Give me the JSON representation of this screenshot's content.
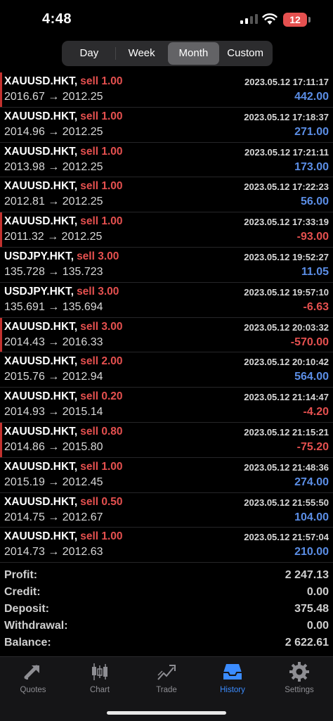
{
  "status_bar": {
    "time": "4:48",
    "battery": "12"
  },
  "period_tabs": [
    "Day",
    "Week",
    "Month",
    "Custom"
  ],
  "active_period": "Month",
  "deals": [
    {
      "symbol": "XAUUSD.HKT,",
      "side": "sell 1.00",
      "prices": "2016.67 → 2012.25",
      "time": "2023.05.12 17:11:17",
      "profit": "442.00",
      "positive": true,
      "flag": true
    },
    {
      "symbol": "XAUUSD.HKT,",
      "side": "sell 1.00",
      "prices": "2014.96 → 2012.25",
      "time": "2023.05.12 17:18:37",
      "profit": "271.00",
      "positive": true,
      "flag": false
    },
    {
      "symbol": "XAUUSD.HKT,",
      "side": "sell 1.00",
      "prices": "2013.98 → 2012.25",
      "time": "2023.05.12 17:21:11",
      "profit": "173.00",
      "positive": true,
      "flag": false
    },
    {
      "symbol": "XAUUSD.HKT,",
      "side": "sell 1.00",
      "prices": "2012.81 → 2012.25",
      "time": "2023.05.12 17:22:23",
      "profit": "56.00",
      "positive": true,
      "flag": false
    },
    {
      "symbol": "XAUUSD.HKT,",
      "side": "sell 1.00",
      "prices": "2011.32 → 2012.25",
      "time": "2023.05.12 17:33:19",
      "profit": "-93.00",
      "positive": false,
      "flag": true
    },
    {
      "symbol": "USDJPY.HKT,",
      "side": "sell 3.00",
      "prices": "135.728 → 135.723",
      "time": "2023.05.12 19:52:27",
      "profit": "11.05",
      "positive": true,
      "flag": false
    },
    {
      "symbol": "USDJPY.HKT,",
      "side": "sell 3.00",
      "prices": "135.691 → 135.694",
      "time": "2023.05.12 19:57:10",
      "profit": "-6.63",
      "positive": false,
      "flag": false
    },
    {
      "symbol": "XAUUSD.HKT,",
      "side": "sell 3.00",
      "prices": "2014.43 → 2016.33",
      "time": "2023.05.12 20:03:32",
      "profit": "-570.00",
      "positive": false,
      "flag": true
    },
    {
      "symbol": "XAUUSD.HKT,",
      "side": "sell 2.00",
      "prices": "2015.76 → 2012.94",
      "time": "2023.05.12 20:10:42",
      "profit": "564.00",
      "positive": true,
      "flag": false
    },
    {
      "symbol": "XAUUSD.HKT,",
      "side": "sell 0.20",
      "prices": "2014.93 → 2015.14",
      "time": "2023.05.12 21:14:47",
      "profit": "-4.20",
      "positive": false,
      "flag": false
    },
    {
      "symbol": "XAUUSD.HKT,",
      "side": "sell 0.80",
      "prices": "2014.86 → 2015.80",
      "time": "2023.05.12 21:15:21",
      "profit": "-75.20",
      "positive": false,
      "flag": true
    },
    {
      "symbol": "XAUUSD.HKT,",
      "side": "sell 1.00",
      "prices": "2015.19 → 2012.45",
      "time": "2023.05.12 21:48:36",
      "profit": "274.00",
      "positive": true,
      "flag": false
    },
    {
      "symbol": "XAUUSD.HKT,",
      "side": "sell 0.50",
      "prices": "2014.75 → 2012.67",
      "time": "2023.05.12 21:55:50",
      "profit": "104.00",
      "positive": true,
      "flag": false
    },
    {
      "symbol": "XAUUSD.HKT,",
      "side": "sell 1.00",
      "prices": "2014.73 → 2012.63",
      "time": "2023.05.12 21:57:04",
      "profit": "210.00",
      "positive": true,
      "flag": false
    }
  ],
  "summary": [
    {
      "label": "Profit:",
      "value": "2 247.13"
    },
    {
      "label": "Credit:",
      "value": "0.00"
    },
    {
      "label": "Deposit:",
      "value": "375.48"
    },
    {
      "label": "Withdrawal:",
      "value": "0.00"
    },
    {
      "label": "Balance:",
      "value": "2 622.61"
    }
  ],
  "tabs": [
    {
      "label": "Quotes",
      "icon": "quotes-icon"
    },
    {
      "label": "Chart",
      "icon": "chart-icon"
    },
    {
      "label": "Trade",
      "icon": "trade-icon"
    },
    {
      "label": "History",
      "icon": "history-icon"
    },
    {
      "label": "Settings",
      "icon": "settings-icon"
    }
  ],
  "active_tab": "History",
  "colors": {
    "profit_positive": "#5b8ee6",
    "profit_negative": "#e5504f",
    "accent": "#3b8cff",
    "loss_flag": "#c3322f"
  }
}
